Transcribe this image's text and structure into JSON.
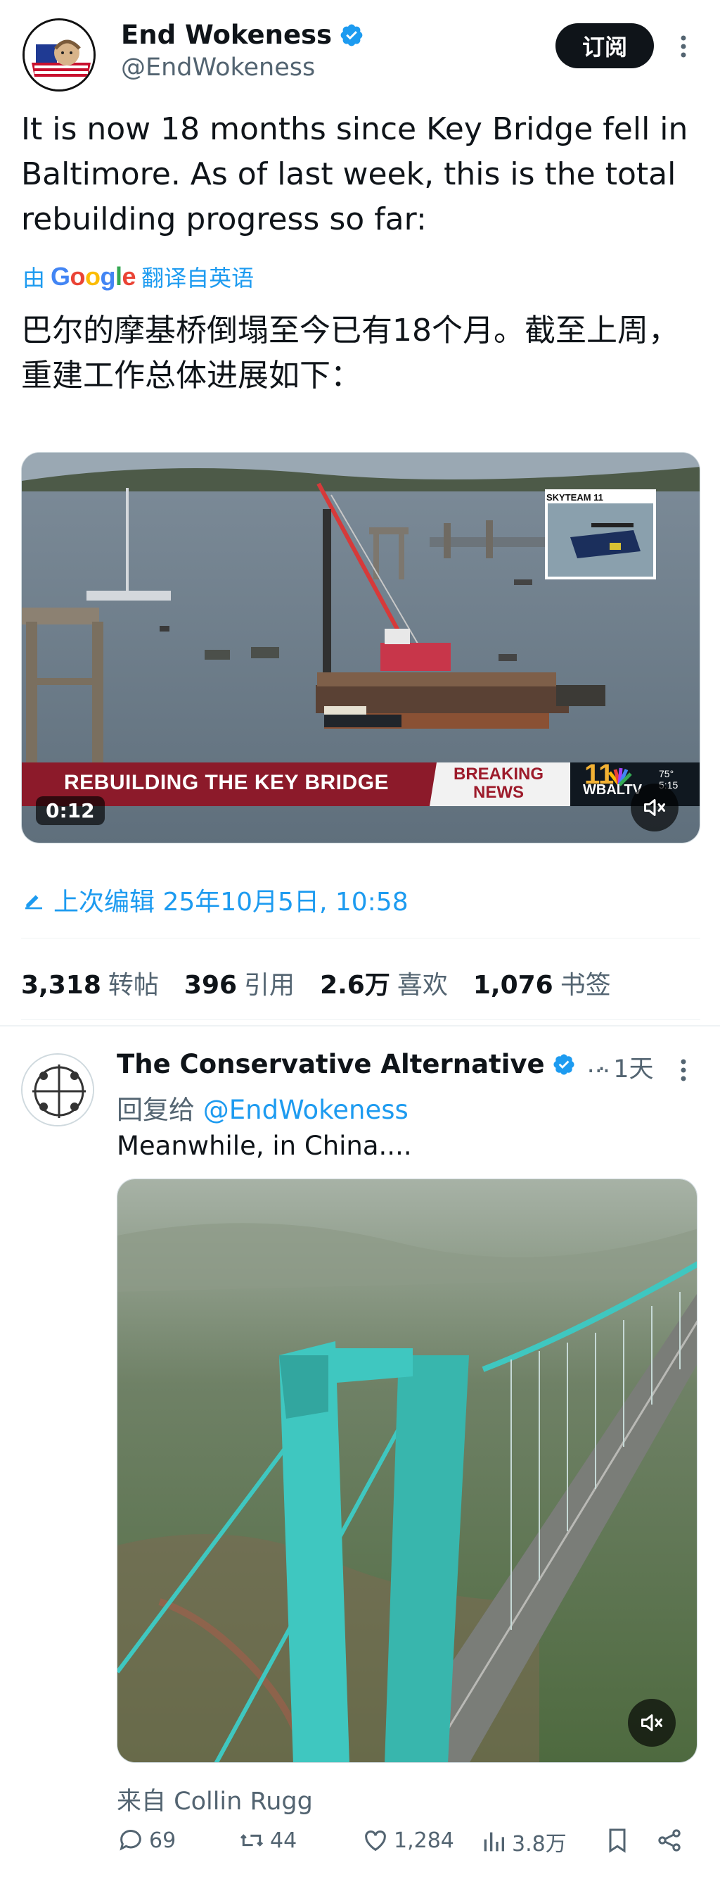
{
  "main_tweet": {
    "display_name": "End Wokeness",
    "handle": "@EndWokeness",
    "subscribe_label": "订阅",
    "text": "It is now 18 months since Key Bridge fell in Baltimore. As of last week, this is the total rebuilding progress so far:",
    "translate_prefix": "由",
    "translate_brand": "Google",
    "translate_suffix": "翻译自英语",
    "translated_text": "巴尔的摩基桥倒塌至今已有18个月。截至上周，重建工作总体进展如下：",
    "video": {
      "banner_title": "REBUILDING THE KEY BRIDGE",
      "breaking_line1": "BREAKING",
      "breaking_line2": "NEWS",
      "station": "WBALTV",
      "channel": "11",
      "temp": "75°",
      "clock": "5:15",
      "inset_label": "SKYTEAM 11",
      "duration": "0:12"
    },
    "edited_label": "上次编辑 25年10月5日, 10:58",
    "stats": [
      {
        "value": "3,318",
        "label": "转帖"
      },
      {
        "value": "396",
        "label": "引用"
      },
      {
        "value": "2.6万",
        "label": "喜欢"
      },
      {
        "value": "1,076",
        "label": "书签"
      }
    ]
  },
  "reply": {
    "display_name": "The Conservative Alternative",
    "ellipsis": "...",
    "time": "· 1天",
    "reply_to_prefix": "回复给 ",
    "reply_to_handle": "@EndWokeness",
    "text": "Meanwhile, in China....",
    "source": "来自 Collin Rugg",
    "actions": {
      "replies": "69",
      "reposts": "44",
      "likes": "1,284",
      "views": "3.8万"
    }
  },
  "colors": {
    "accent": "#1d9bf0",
    "text_primary": "#0f1419",
    "text_secondary": "#536471",
    "bridge_teal": "#3fc7c0"
  }
}
